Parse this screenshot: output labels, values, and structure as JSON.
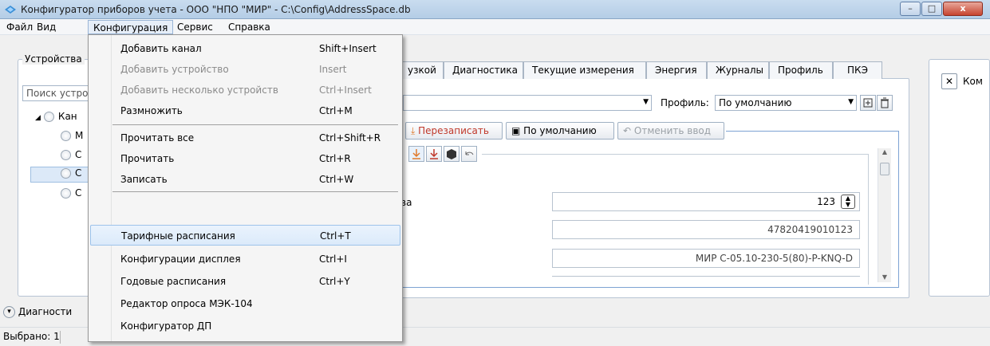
{
  "window": {
    "title": "Конфигуратор приборов учета - ООО \"НПО \"МИР\" - C:\\Config\\AddressSpace.db",
    "minimize": "–",
    "maximize": "□",
    "close": "x"
  },
  "menubar": [
    "Файл",
    "Вид",
    "Конфигурация",
    "Сервис",
    "Справка"
  ],
  "left_panel": {
    "group_label": "Устройства",
    "search_placeholder": "Поиск устро",
    "tree": [
      {
        "label": "Кан",
        "expander": "◢"
      },
      {
        "label": "М"
      },
      {
        "label": "С"
      },
      {
        "label": "С"
      },
      {
        "label": "С"
      }
    ],
    "diagnostics_label": "Диагности",
    "diagnostics_icon": "chevron-down-icon"
  },
  "tabs": [
    "узкой",
    "Диагностика",
    "Текущие измерения",
    "Энергия",
    "Журналы",
    "Профиль",
    "ПКЭ"
  ],
  "profile": {
    "label": "Профиль:",
    "value": "По умолчанию"
  },
  "toolbar": {
    "rewrite": "Перезаписать",
    "defaults": "По умолчанию",
    "cancel": "Отменить ввод"
  },
  "fields": {
    "row1_label": "ва",
    "row1_value": "123",
    "row2_value": "47820419010123",
    "row3_value": "МИР С-05.10-230-5(80)-P-KNQ-D"
  },
  "right_panel": {
    "close_icon": "✕",
    "label": "Ком"
  },
  "status": {
    "selected": "Выбрано: 1"
  },
  "menu": {
    "items": [
      {
        "label": "Добавить канал",
        "shortcut": "Shift+Insert",
        "disabled": false
      },
      {
        "label": "Добавить устройство",
        "shortcut": "Insert",
        "disabled": true
      },
      {
        "label": "Добавить несколько устройств",
        "shortcut": "Ctrl+Insert",
        "disabled": true
      },
      {
        "label": "Размножить",
        "shortcut": "Ctrl+M",
        "disabled": false
      },
      {
        "label": "Прочитать все",
        "shortcut": "Ctrl+Shift+R",
        "disabled": false
      },
      {
        "label": "Прочитать",
        "shortcut": "Ctrl+R",
        "disabled": false
      },
      {
        "label": "Записать",
        "shortcut": "Ctrl+W",
        "disabled": false
      },
      {
        "label": "Тарифные расписания",
        "shortcut": "Ctrl+T",
        "disabled": false,
        "highlighted": true
      },
      {
        "label": "Конфигурации дисплея",
        "shortcut": "Ctrl+I",
        "disabled": false
      },
      {
        "label": "Годовые расписания",
        "shortcut": "Ctrl+Y",
        "disabled": false
      },
      {
        "label": "Редактор опроса МЭК-104",
        "shortcut": "",
        "disabled": false
      },
      {
        "label": "Конфигуратор ДП",
        "shortcut": "",
        "disabled": false
      }
    ]
  }
}
